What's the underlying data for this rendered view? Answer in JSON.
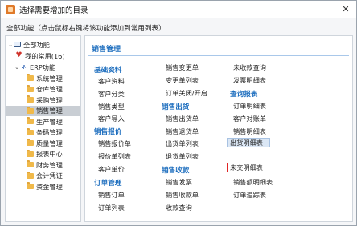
{
  "window": {
    "title": "选择需要增加的目录",
    "close": "✕"
  },
  "hint": "全部功能（点击鼠标右键将该功能添加到常用列表）",
  "tree": {
    "root": "全部功能",
    "favorites": "我的常用(16)",
    "erp": "ERP功能",
    "modules": [
      "系统管理",
      "仓库管理",
      "采购管理",
      "销售管理",
      "生产管理",
      "条码管理",
      "质量管理",
      "报表中心",
      "财务管理",
      "会计凭证",
      "资金管理"
    ],
    "selected_index": 3
  },
  "content": {
    "title": "销售管理",
    "sections": {
      "basic": {
        "title": "基础资料",
        "items": [
          "客户资料",
          "客户分类",
          "销售类型",
          "客户导入"
        ]
      },
      "quote": {
        "title": "销售报价",
        "items": [
          "销售报价单",
          "报价单列表",
          "客户单价"
        ]
      },
      "order": {
        "title": "订单管理",
        "items": [
          "销售订单",
          "订单列表"
        ]
      },
      "col2_top": {
        "items": [
          "销售变更单",
          "变更单列表",
          "订单关闭/开启"
        ]
      },
      "ship": {
        "title": "销售出货",
        "items": [
          "销售出货单",
          "销售退货单",
          "出货单列表",
          "退货单列表"
        ]
      },
      "receipt": {
        "title": "销售收款",
        "items": [
          "销售发票",
          "销售收款单",
          "收款查询"
        ]
      },
      "col3_top": {
        "items": [
          "未收款查询",
          "发票明细表"
        ]
      },
      "query": {
        "title": "查询报表",
        "items": [
          "订单明细表",
          "客户对账单",
          "销售明细表",
          "出货明细表",
          "未交明细表",
          "销售额明细表",
          "订单追踪表"
        ]
      }
    }
  },
  "colors": {
    "accent": "#1f6fbf",
    "highlight_box": "#e02424",
    "selected_row": "#c9ced4"
  }
}
